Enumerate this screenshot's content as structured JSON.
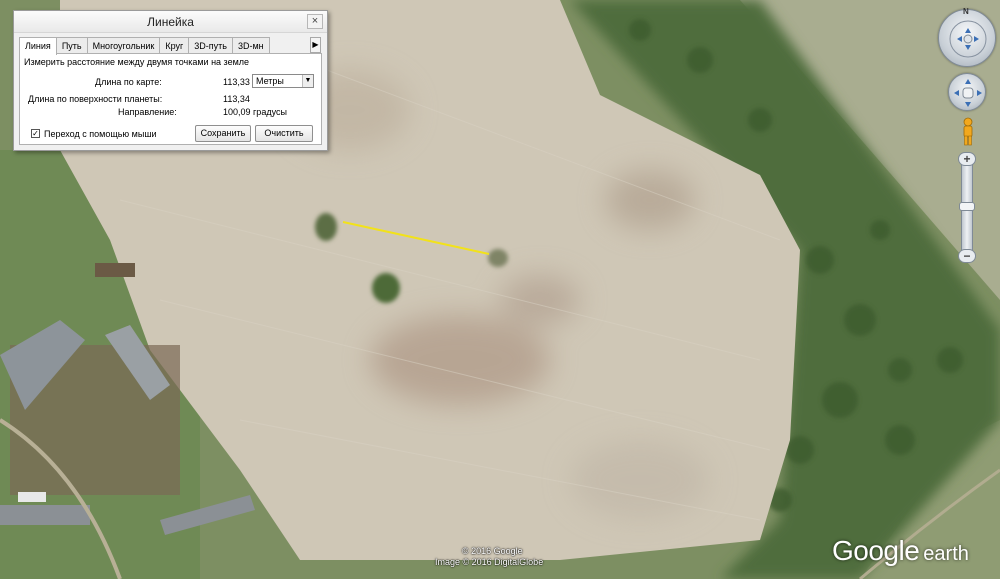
{
  "ruler": {
    "title": "Линейка",
    "close_symbol": "×",
    "tabs": [
      "Линия",
      "Путь",
      "Многоугольник",
      "Круг",
      "3D-путь",
      "3D-мн"
    ],
    "active_tab": "Линия",
    "tab_scroll_right": "▶",
    "description": "Измерить расстояние между двумя точками на земле",
    "map_length_label": "Длина по карте:",
    "map_length_value": "113,33",
    "unit_selected": "Метры",
    "surface_length_label": "Длина по поверхности планеты:",
    "surface_length_value": "113,34",
    "heading_label": "Направление:",
    "heading_value": "100,09 градусы",
    "mouse_nav_label": "Переход с помощью мыши",
    "mouse_nav_checked": true,
    "save_label": "Сохранить",
    "clear_label": "Очистить"
  },
  "nav": {
    "north_label": "N",
    "zoom_in": "+",
    "zoom_out": "−",
    "icons": [
      "compass-icon",
      "look-joystick-icon",
      "pegman-icon",
      "zoom-slider"
    ]
  },
  "credits": {
    "copyright": "© 2016 Google",
    "imagery": "Image © 2016 DigitalGlobe"
  },
  "logo": {
    "google": "Google",
    "earth": "earth"
  },
  "colors": {
    "measure_line": "#f2e21a",
    "field": "#cfc7b6",
    "vegetation": "#4f6d3c"
  }
}
